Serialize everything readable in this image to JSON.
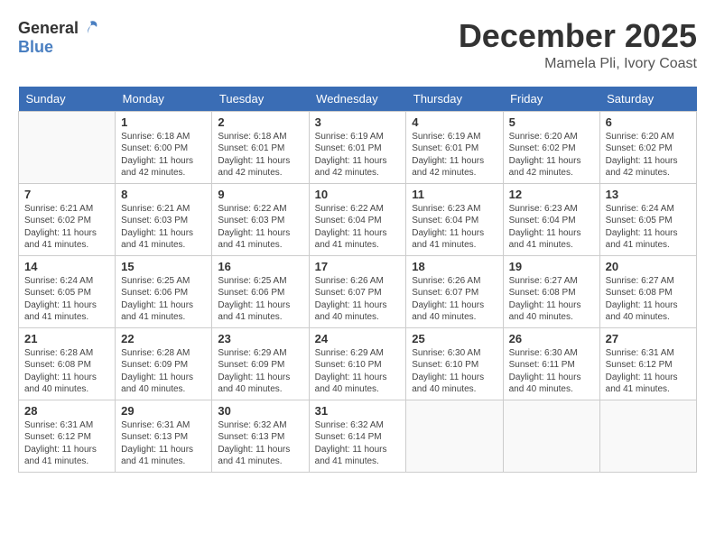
{
  "header": {
    "logo_general": "General",
    "logo_blue": "Blue",
    "month": "December 2025",
    "location": "Mamela Pli, Ivory Coast"
  },
  "weekdays": [
    "Sunday",
    "Monday",
    "Tuesday",
    "Wednesday",
    "Thursday",
    "Friday",
    "Saturday"
  ],
  "weeks": [
    [
      {
        "day": "",
        "info": ""
      },
      {
        "day": "1",
        "info": "Sunrise: 6:18 AM\nSunset: 6:00 PM\nDaylight: 11 hours\nand 42 minutes."
      },
      {
        "day": "2",
        "info": "Sunrise: 6:18 AM\nSunset: 6:01 PM\nDaylight: 11 hours\nand 42 minutes."
      },
      {
        "day": "3",
        "info": "Sunrise: 6:19 AM\nSunset: 6:01 PM\nDaylight: 11 hours\nand 42 minutes."
      },
      {
        "day": "4",
        "info": "Sunrise: 6:19 AM\nSunset: 6:01 PM\nDaylight: 11 hours\nand 42 minutes."
      },
      {
        "day": "5",
        "info": "Sunrise: 6:20 AM\nSunset: 6:02 PM\nDaylight: 11 hours\nand 42 minutes."
      },
      {
        "day": "6",
        "info": "Sunrise: 6:20 AM\nSunset: 6:02 PM\nDaylight: 11 hours\nand 42 minutes."
      }
    ],
    [
      {
        "day": "7",
        "info": "Sunrise: 6:21 AM\nSunset: 6:02 PM\nDaylight: 11 hours\nand 41 minutes."
      },
      {
        "day": "8",
        "info": "Sunrise: 6:21 AM\nSunset: 6:03 PM\nDaylight: 11 hours\nand 41 minutes."
      },
      {
        "day": "9",
        "info": "Sunrise: 6:22 AM\nSunset: 6:03 PM\nDaylight: 11 hours\nand 41 minutes."
      },
      {
        "day": "10",
        "info": "Sunrise: 6:22 AM\nSunset: 6:04 PM\nDaylight: 11 hours\nand 41 minutes."
      },
      {
        "day": "11",
        "info": "Sunrise: 6:23 AM\nSunset: 6:04 PM\nDaylight: 11 hours\nand 41 minutes."
      },
      {
        "day": "12",
        "info": "Sunrise: 6:23 AM\nSunset: 6:04 PM\nDaylight: 11 hours\nand 41 minutes."
      },
      {
        "day": "13",
        "info": "Sunrise: 6:24 AM\nSunset: 6:05 PM\nDaylight: 11 hours\nand 41 minutes."
      }
    ],
    [
      {
        "day": "14",
        "info": "Sunrise: 6:24 AM\nSunset: 6:05 PM\nDaylight: 11 hours\nand 41 minutes."
      },
      {
        "day": "15",
        "info": "Sunrise: 6:25 AM\nSunset: 6:06 PM\nDaylight: 11 hours\nand 41 minutes."
      },
      {
        "day": "16",
        "info": "Sunrise: 6:25 AM\nSunset: 6:06 PM\nDaylight: 11 hours\nand 41 minutes."
      },
      {
        "day": "17",
        "info": "Sunrise: 6:26 AM\nSunset: 6:07 PM\nDaylight: 11 hours\nand 40 minutes."
      },
      {
        "day": "18",
        "info": "Sunrise: 6:26 AM\nSunset: 6:07 PM\nDaylight: 11 hours\nand 40 minutes."
      },
      {
        "day": "19",
        "info": "Sunrise: 6:27 AM\nSunset: 6:08 PM\nDaylight: 11 hours\nand 40 minutes."
      },
      {
        "day": "20",
        "info": "Sunrise: 6:27 AM\nSunset: 6:08 PM\nDaylight: 11 hours\nand 40 minutes."
      }
    ],
    [
      {
        "day": "21",
        "info": "Sunrise: 6:28 AM\nSunset: 6:08 PM\nDaylight: 11 hours\nand 40 minutes."
      },
      {
        "day": "22",
        "info": "Sunrise: 6:28 AM\nSunset: 6:09 PM\nDaylight: 11 hours\nand 40 minutes."
      },
      {
        "day": "23",
        "info": "Sunrise: 6:29 AM\nSunset: 6:09 PM\nDaylight: 11 hours\nand 40 minutes."
      },
      {
        "day": "24",
        "info": "Sunrise: 6:29 AM\nSunset: 6:10 PM\nDaylight: 11 hours\nand 40 minutes."
      },
      {
        "day": "25",
        "info": "Sunrise: 6:30 AM\nSunset: 6:10 PM\nDaylight: 11 hours\nand 40 minutes."
      },
      {
        "day": "26",
        "info": "Sunrise: 6:30 AM\nSunset: 6:11 PM\nDaylight: 11 hours\nand 40 minutes."
      },
      {
        "day": "27",
        "info": "Sunrise: 6:31 AM\nSunset: 6:12 PM\nDaylight: 11 hours\nand 41 minutes."
      }
    ],
    [
      {
        "day": "28",
        "info": "Sunrise: 6:31 AM\nSunset: 6:12 PM\nDaylight: 11 hours\nand 41 minutes."
      },
      {
        "day": "29",
        "info": "Sunrise: 6:31 AM\nSunset: 6:13 PM\nDaylight: 11 hours\nand 41 minutes."
      },
      {
        "day": "30",
        "info": "Sunrise: 6:32 AM\nSunset: 6:13 PM\nDaylight: 11 hours\nand 41 minutes."
      },
      {
        "day": "31",
        "info": "Sunrise: 6:32 AM\nSunset: 6:14 PM\nDaylight: 11 hours\nand 41 minutes."
      },
      {
        "day": "",
        "info": ""
      },
      {
        "day": "",
        "info": ""
      },
      {
        "day": "",
        "info": ""
      }
    ]
  ]
}
